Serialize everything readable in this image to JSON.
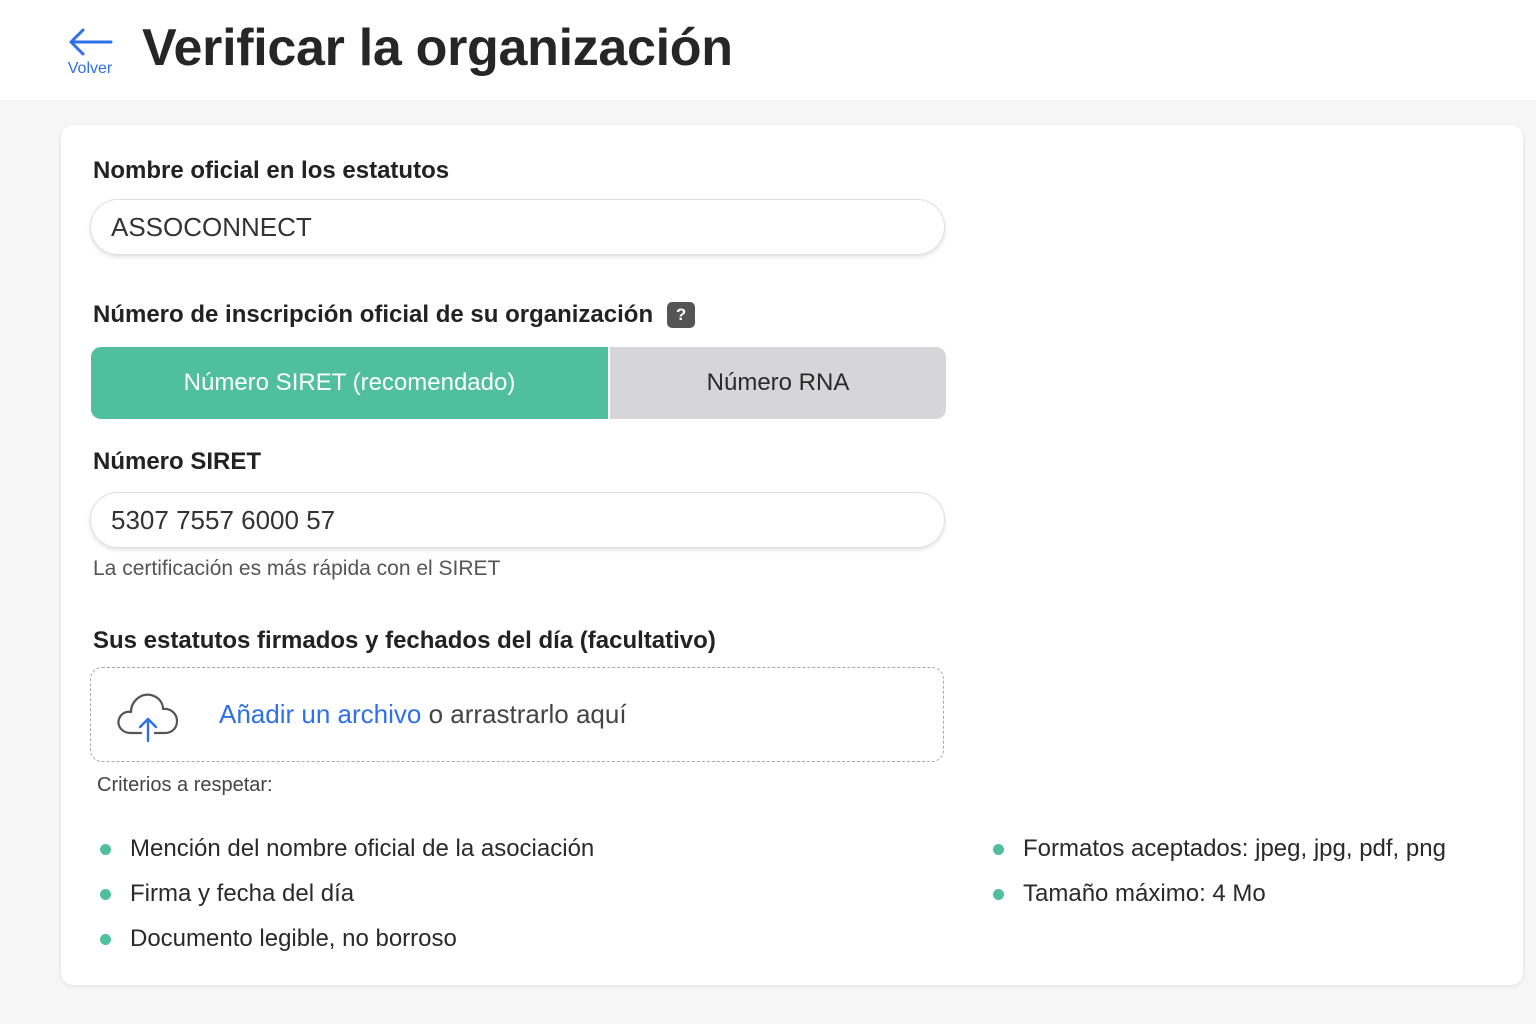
{
  "header": {
    "back_label": "Volver",
    "title": "Verificar la organización"
  },
  "form": {
    "official_name": {
      "label": "Nombre oficial en los estatutos",
      "value": "ASSOCONNECT"
    },
    "registration": {
      "label": "Número de inscripción oficial de su organización",
      "help_icon": "?",
      "options": [
        {
          "label": "Número SIRET (recomendado)",
          "selected": true
        },
        {
          "label": "Número RNA",
          "selected": false
        }
      ]
    },
    "siret": {
      "label": "Número SIRET",
      "value": "5307 7557 6000 57",
      "hint": "La certificación es más rápida con el SIRET"
    },
    "statutes": {
      "label": "Sus estatutos firmados y fechados del día (facultativo)",
      "upload_link": "Añadir un archivo",
      "upload_text": " o arrastrarlo aquí",
      "upload_icon": "cloud-upload-icon"
    },
    "criteria": {
      "title": "Criterios a respetar:",
      "left": [
        "Mención del nombre oficial de la asociación",
        "Firma y fecha del día",
        "Documento legible, no borroso"
      ],
      "right": [
        "Formatos aceptados: jpeg, jpg, pdf, png",
        "Tamaño máximo: 4 Mo"
      ]
    }
  },
  "colors": {
    "accent_green": "#4fbf9d",
    "link_blue": "#2f6fe8",
    "inactive_gray": "#d6d6d8"
  }
}
